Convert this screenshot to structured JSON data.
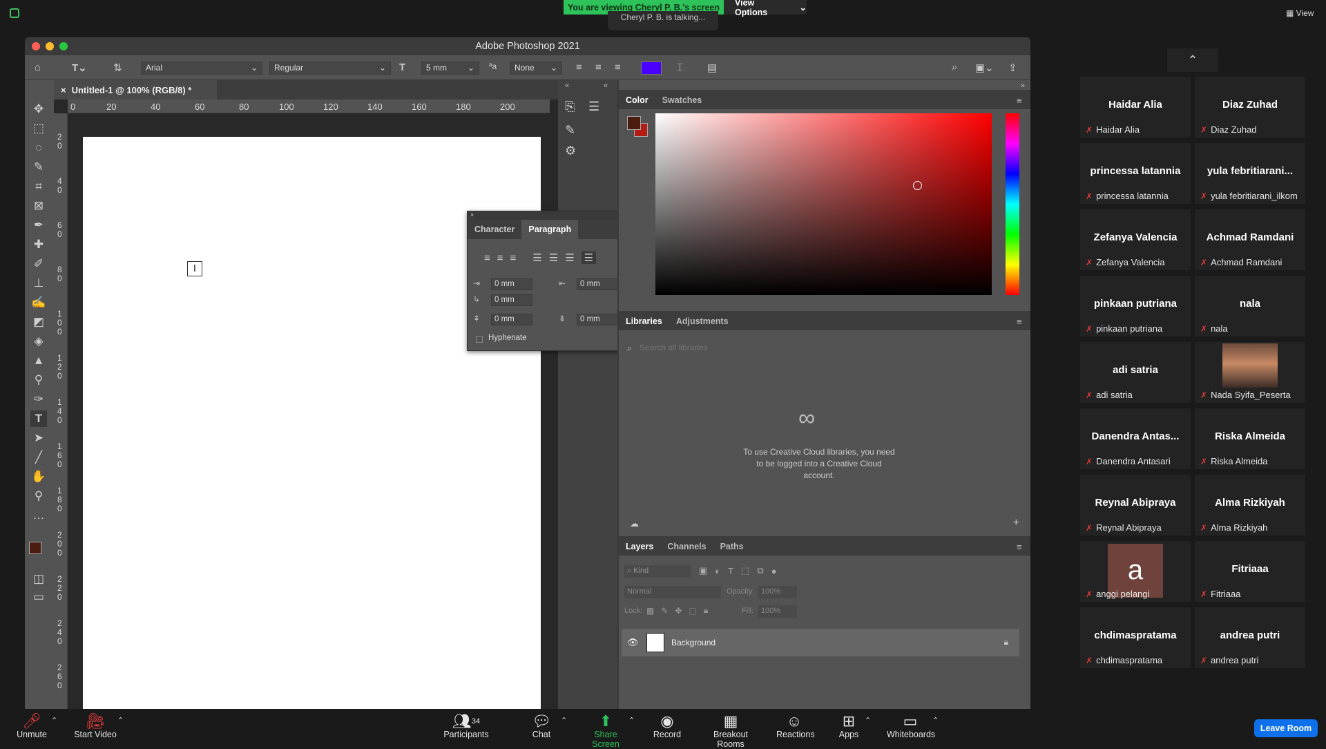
{
  "zoom": {
    "viewing_banner": "You are viewing Cheryl P. B.'s screen",
    "view_options": "View Options",
    "talking": "Cheryl P. B. is talking...",
    "view_label": "View",
    "leave_room": "Leave Room",
    "participants_count": "34",
    "bottom_buttons": {
      "unmute": "Unmute",
      "start_video": "Start Video",
      "participants": "Participants",
      "chat": "Chat",
      "share_screen": "Share Screen",
      "record": "Record",
      "breakout_rooms": "Breakout Rooms",
      "reactions": "Reactions",
      "apps": "Apps",
      "whiteboards": "Whiteboards"
    },
    "gallery": [
      {
        "name": "Haidar Alia",
        "label": "Haidar Alia"
      },
      {
        "name": "Diaz Zuhad",
        "label": "Diaz Zuhad"
      },
      {
        "name": "princessa latannia",
        "label": "princessa latannia"
      },
      {
        "name": "yula febritiarani...",
        "label": "yula febritiarani_ilkom"
      },
      {
        "name": "Zefanya Valencia",
        "label": "Zefanya Valencia"
      },
      {
        "name": "Achmad Ramdani",
        "label": "Achmad Ramdani"
      },
      {
        "name": "pinkaan putriana",
        "label": "pinkaan putriana"
      },
      {
        "name": "nala",
        "label": "nala"
      },
      {
        "name": "adi satria",
        "label": "adi satria"
      },
      {
        "name": "",
        "label": "Nada Syifa_Peserta"
      },
      {
        "name": "Danendra Antas...",
        "label": "Danendra Antasari"
      },
      {
        "name": "Riska Almeida",
        "label": "Riska Almeida"
      },
      {
        "name": "Reynal Abipraya",
        "label": "Reynal Abipraya"
      },
      {
        "name": "Alma Rizkiyah",
        "label": "Alma Rizkiyah"
      },
      {
        "name": "a",
        "label": "anggi pelangi"
      },
      {
        "name": "Fitriaaa",
        "label": "Fitriaaa"
      },
      {
        "name": "chdimaspratama",
        "label": "chdimaspratama"
      },
      {
        "name": "andrea putri",
        "label": "andrea putri"
      }
    ]
  },
  "photoshop": {
    "title": "Adobe Photoshop 2021",
    "font_family": "Arial",
    "font_style": "Regular",
    "font_size": "5 mm",
    "antialias": "None",
    "text_color": "#4a00ff",
    "doc_tab": "Untitled-1 @ 100% (RGB/8) *",
    "ruler_h": [
      "0",
      "20",
      "40",
      "60",
      "80",
      "100",
      "120",
      "140",
      "160",
      "180",
      "200"
    ],
    "ruler_v": [
      "2 0",
      "4 0",
      "6 0",
      "8 0",
      "1 0 0",
      "1 2 0",
      "1 4 0",
      "1 6 0",
      "1 8 0",
      "2 0 0",
      "2 2 0",
      "2 4 0",
      "2 6 0"
    ],
    "paragraph_panel": {
      "tab_character": "Character",
      "tab_paragraph": "Paragraph",
      "indent_left": "0 mm",
      "indent_right": "0 mm",
      "indent_first": "0 mm",
      "space_before": "0 mm",
      "space_after": "0 mm",
      "hyphenate": "Hyphenate"
    },
    "color_panel": {
      "tab_color": "Color",
      "tab_swatches": "Swatches",
      "foreground": "#4a1d10",
      "background": "#b51c16"
    },
    "libraries_panel": {
      "tab_libraries": "Libraries",
      "tab_adjustments": "Adjustments",
      "search_placeholder": "Search all libraries",
      "message": "To use Creative Cloud libraries, you need to be logged into a Creative Cloud account."
    },
    "layers_panel": {
      "tab_layers": "Layers",
      "tab_channels": "Channels",
      "tab_paths": "Paths",
      "kind": "Kind",
      "blend": "Normal",
      "opacity_label": "Opacity:",
      "opacity_value": "100%",
      "lock_label": "Lock:",
      "fill_label": "Fill:",
      "fill_value": "100%",
      "layer_name": "Background"
    }
  }
}
